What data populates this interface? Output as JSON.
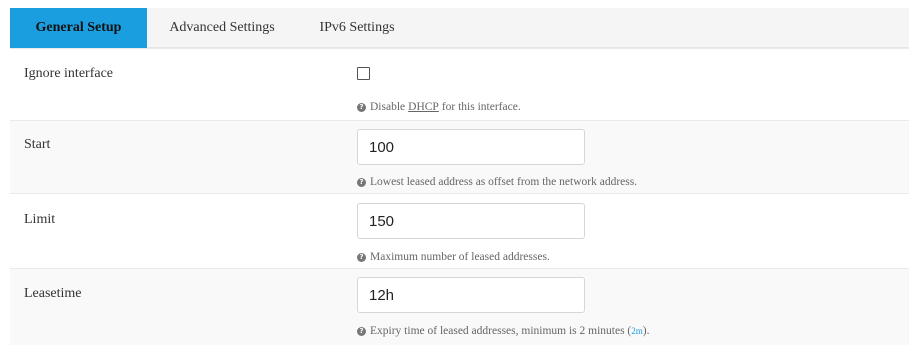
{
  "tabs": [
    {
      "label": "General Setup",
      "active": true
    },
    {
      "label": "Advanced Settings",
      "active": false
    },
    {
      "label": "IPv6 Settings",
      "active": false
    }
  ],
  "accent_color": "#1a9ee0",
  "rows": {
    "ignore": {
      "label": "Ignore interface",
      "checked": false,
      "help_pre": "Disable",
      "help_abbr": "DHCP",
      "help_post": "for this interface."
    },
    "start": {
      "label": "Start",
      "value": "100",
      "help": "Lowest leased address as offset from the network address."
    },
    "limit": {
      "label": "Limit",
      "value": "150",
      "help": "Maximum number of leased addresses."
    },
    "leasetime": {
      "label": "Leasetime",
      "value": "12h",
      "help_pre": "Expiry time of leased addresses, minimum is 2 minutes (",
      "help_link": "2m",
      "help_post": ")."
    }
  },
  "icons": {
    "help": "info-icon"
  }
}
